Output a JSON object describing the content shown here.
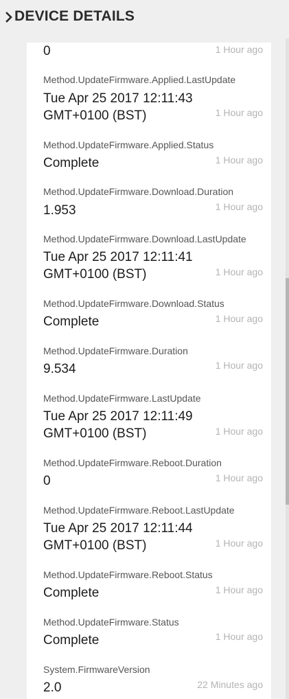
{
  "header": {
    "title": "DEVICE DETAILS",
    "chevron_icon": "chevron-right-icon"
  },
  "properties": [
    {
      "name": "",
      "value": "0",
      "time": "1 Hour ago"
    },
    {
      "name": "Method.UpdateFirmware.Applied.LastUpdate",
      "value": "Tue Apr 25 2017 12:11:43\nGMT+0100 (BST)",
      "time": "1 Hour ago"
    },
    {
      "name": "Method.UpdateFirmware.Applied.Status",
      "value": "Complete",
      "time": "1 Hour ago"
    },
    {
      "name": "Method.UpdateFirmware.Download.Duration",
      "value": "1.953",
      "time": "1 Hour ago"
    },
    {
      "name": "Method.UpdateFirmware.Download.LastUpdate",
      "value": "Tue Apr 25 2017 12:11:41\nGMT+0100 (BST)",
      "time": "1 Hour ago"
    },
    {
      "name": "Method.UpdateFirmware.Download.Status",
      "value": "Complete",
      "time": "1 Hour ago"
    },
    {
      "name": "Method.UpdateFirmware.Duration",
      "value": "9.534",
      "time": "1 Hour ago"
    },
    {
      "name": "Method.UpdateFirmware.LastUpdate",
      "value": "Tue Apr 25 2017 12:11:49\nGMT+0100 (BST)",
      "time": "1 Hour ago"
    },
    {
      "name": "Method.UpdateFirmware.Reboot.Duration",
      "value": "0",
      "time": "1 Hour ago"
    },
    {
      "name": "Method.UpdateFirmware.Reboot.LastUpdate",
      "value": "Tue Apr 25 2017 12:11:44\nGMT+0100 (BST)",
      "time": "1 Hour ago"
    },
    {
      "name": "Method.UpdateFirmware.Reboot.Status",
      "value": "Complete",
      "time": "1 Hour ago"
    },
    {
      "name": "Method.UpdateFirmware.Status",
      "value": "Complete",
      "time": "1 Hour ago"
    },
    {
      "name": "System.FirmwareVersion",
      "value": "2.0",
      "time": "22 Minutes ago"
    }
  ],
  "colors": {
    "background": "#efefef",
    "panel": "#ffffff",
    "title": "#2b2b2b",
    "timestamp": "#b3b3b3"
  }
}
